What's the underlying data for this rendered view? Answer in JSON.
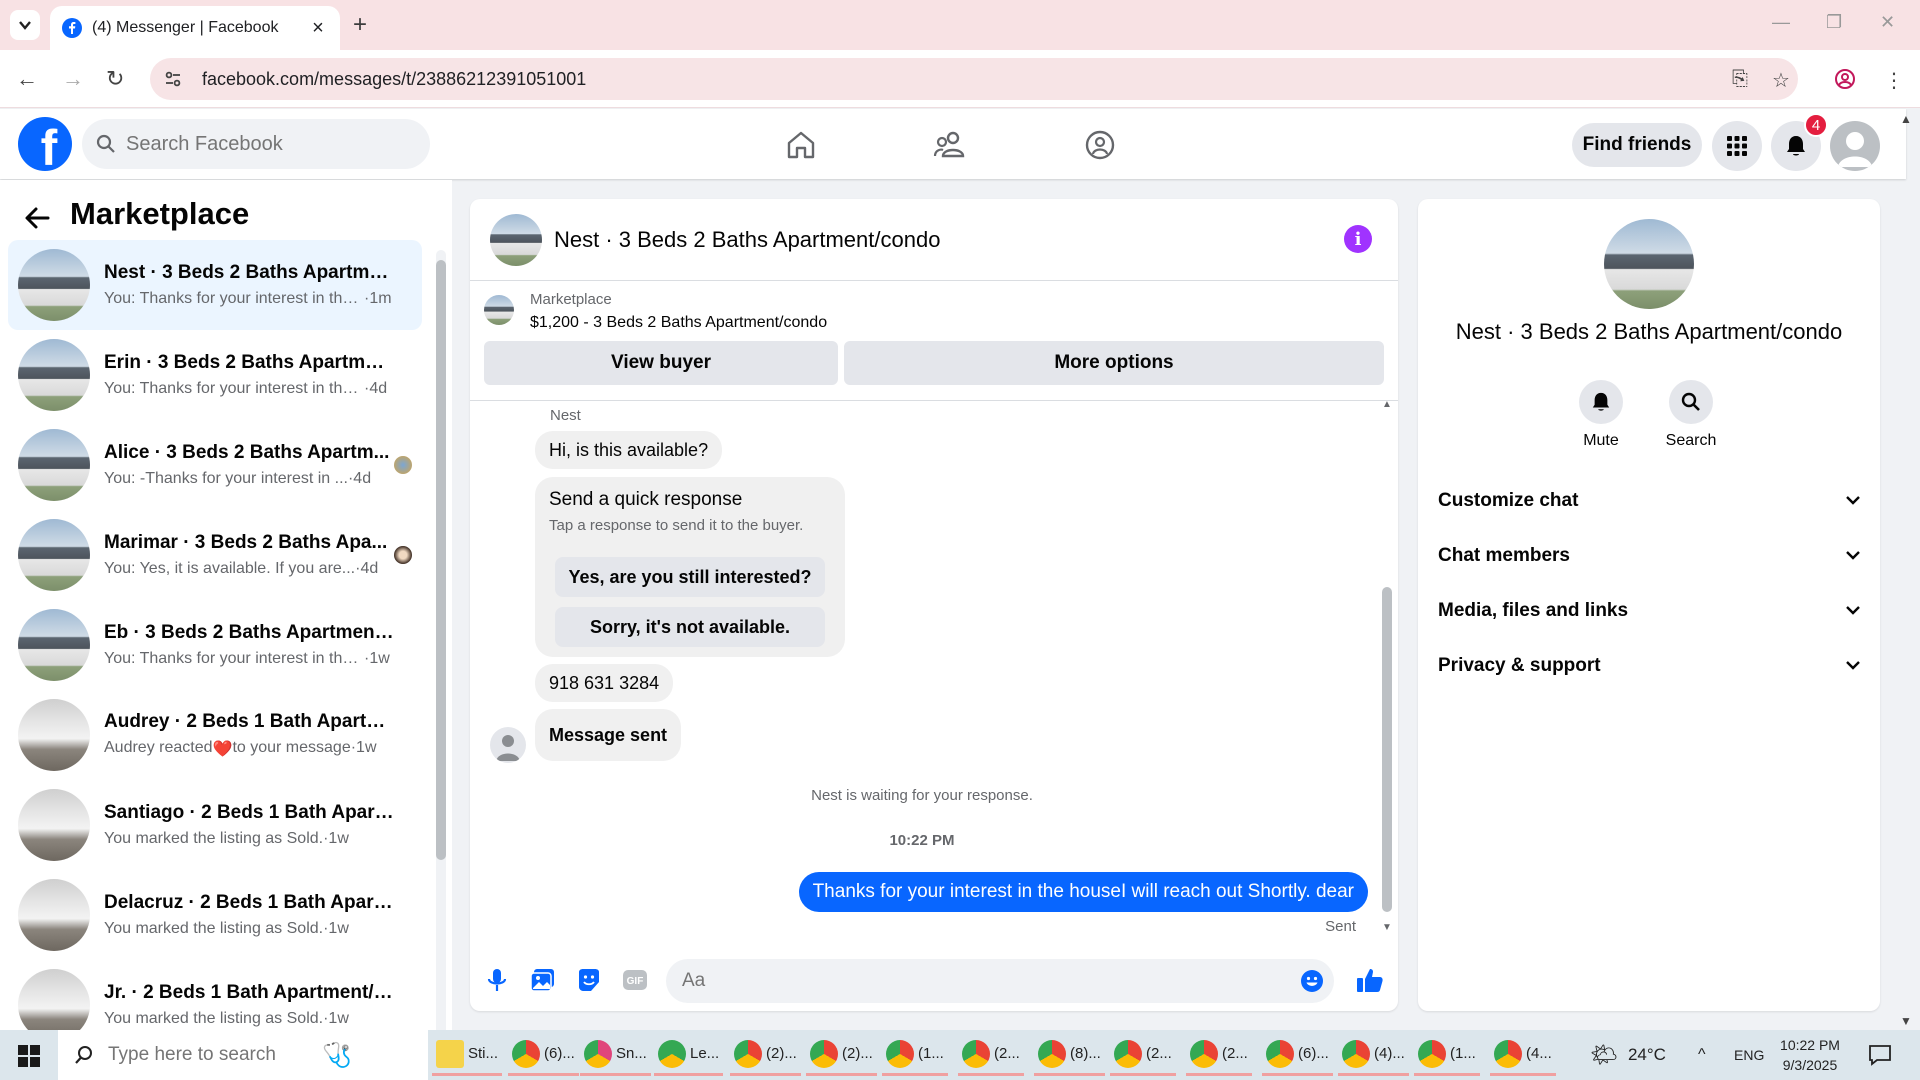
{
  "browser": {
    "tab_title": "(4) Messenger | Facebook",
    "url": "facebook.com/messages/t/23886212391051001"
  },
  "fb_header": {
    "search_placeholder": "Search Facebook",
    "find_friends_label": "Find friends",
    "notification_count": "4"
  },
  "left_panel": {
    "title": "Marketplace",
    "conversations": [
      {
        "name": "Nest · 3 Beds 2 Baths Apartment...",
        "preview": "You: Thanks for your interest in the...",
        "time": "1m",
        "thumb": "house"
      },
      {
        "name": "Erin · 3 Beds 2 Baths Apartment...",
        "preview": "You: Thanks for your interest in the ...",
        "time": "4d",
        "thumb": "house"
      },
      {
        "name": "Alice · 3 Beds 2 Baths Apartm...",
        "preview": "You: -Thanks for your interest in ...",
        "time": "4d",
        "thumb": "house"
      },
      {
        "name": "Marimar · 3 Beds 2 Baths Apa...",
        "preview": "You: Yes, it is available. If you are...",
        "time": "4d",
        "thumb": "house"
      },
      {
        "name": "Eb · 3 Beds 2 Baths Apartment/c...",
        "preview": "You: Thanks for your interest in the...",
        "time": "1w",
        "thumb": "house"
      },
      {
        "name": "Audrey · 2 Beds 1 Bath Apartme...",
        "preview": "Audrey reacted",
        "preview_after": "to your message",
        "time": "1w",
        "thumb": "room"
      },
      {
        "name": "Santiago · 2 Beds 1 Bath Apartm...",
        "preview": "You marked the listing as Sold.",
        "time": "1w",
        "thumb": "room"
      },
      {
        "name": "Delacruz · 2 Beds 1 Bath Apartm...",
        "preview": "You marked the listing as Sold.",
        "time": "1w",
        "thumb": "room"
      },
      {
        "name": "Jr. · 2 Beds 1 Bath Apartment/co...",
        "preview": "You marked the listing as Sold.",
        "time": "1w",
        "thumb": "room"
      }
    ]
  },
  "chat": {
    "title": "Nest · 3 Beds 2 Baths Apartment/condo",
    "listing_source": "Marketplace",
    "listing_detail": "$1,200 - 3 Beds 2 Baths Apartment/condo",
    "view_buyer_label": "View buyer",
    "more_options_label": "More options",
    "sender_name": "Nest",
    "msg_1": "Hi, is this available?",
    "quick_response_title": "Send a quick response",
    "quick_response_sub": "Tap a response to send it to the buyer.",
    "quick_reply_1": "Yes, are you still interested?",
    "quick_reply_2": "Sorry, it's not available.",
    "msg_2": "918 631 3284",
    "msg_3": "Message sent",
    "waiting_text": "Nest is waiting for your response.",
    "timestamp": "10:22 PM",
    "outgoing_msg": "Thanks for your interest in the houseI will reach out Shortly. dear",
    "sent_label": "Sent",
    "composer_placeholder": "Aa"
  },
  "right_panel": {
    "title": "Nest · 3 Beds 2 Baths Apartment/condo",
    "mute_label": "Mute",
    "search_label": "Search",
    "sections": [
      "Customize chat",
      "Chat members",
      "Media, files and links",
      "Privacy & support"
    ]
  },
  "taskbar": {
    "search_placeholder": "Type here to search",
    "apps": [
      "Sti...",
      "(6)...",
      "Sn...",
      "Le...",
      "(2)...",
      "(2)...",
      "(1...",
      "(2...",
      "(8)...",
      "(2...",
      "(2...",
      "(6)...",
      "(4)...",
      "(1...",
      "(4..."
    ],
    "weather": "24°C",
    "language": "ENG",
    "time": "10:22 PM",
    "date": "9/3/2025"
  },
  "colors": {
    "fb_blue": "#0866ff",
    "info_purple": "#a033ff",
    "badge_red": "#e41e3f"
  }
}
